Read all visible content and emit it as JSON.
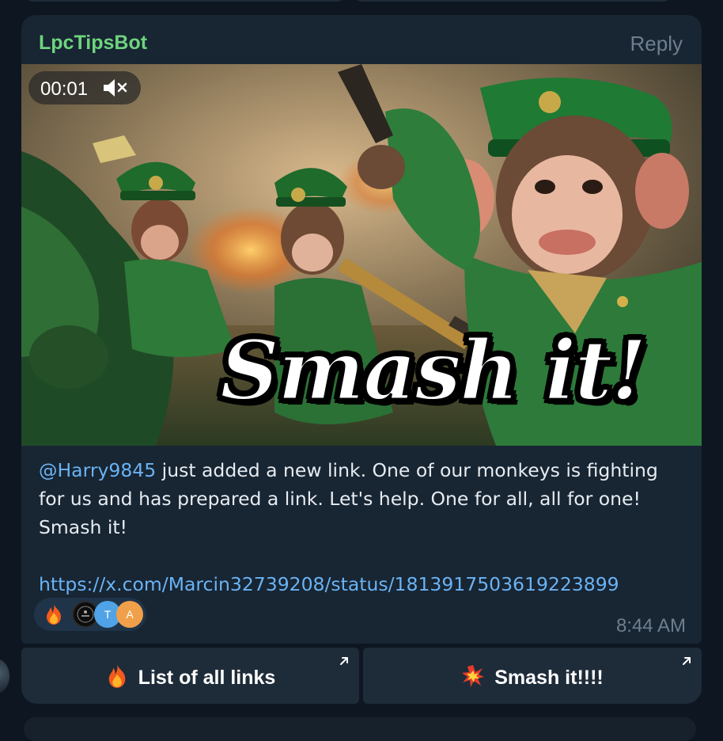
{
  "message": {
    "sender": "LpcTipsBot",
    "reply_label": "Reply",
    "media": {
      "duration": "00:01",
      "muted": true,
      "caption": "Smash it!"
    },
    "text": {
      "mention": "@Harry9845",
      "body": " just added a new link. One of our monkeys is fighting for us and has prepared a link. Let's help. One for all, all for one! Smash it!",
      "link": "https://x.com/Marcin32739208/status/1813917503619223899"
    },
    "reactions": {
      "emoji": "fire",
      "avatars": [
        "",
        "T",
        "A"
      ]
    },
    "time": "8:44 AM"
  },
  "keyboard": {
    "buttons": [
      {
        "emoji": "fire",
        "label": "List of all links"
      },
      {
        "emoji": "collision",
        "label": "Smash it!!!!"
      }
    ]
  },
  "colors": {
    "background": "#0e1621",
    "bubble": "#182533",
    "sender": "#6ed47e",
    "link": "#6ab3f3",
    "meta": "#6d7f8f"
  }
}
